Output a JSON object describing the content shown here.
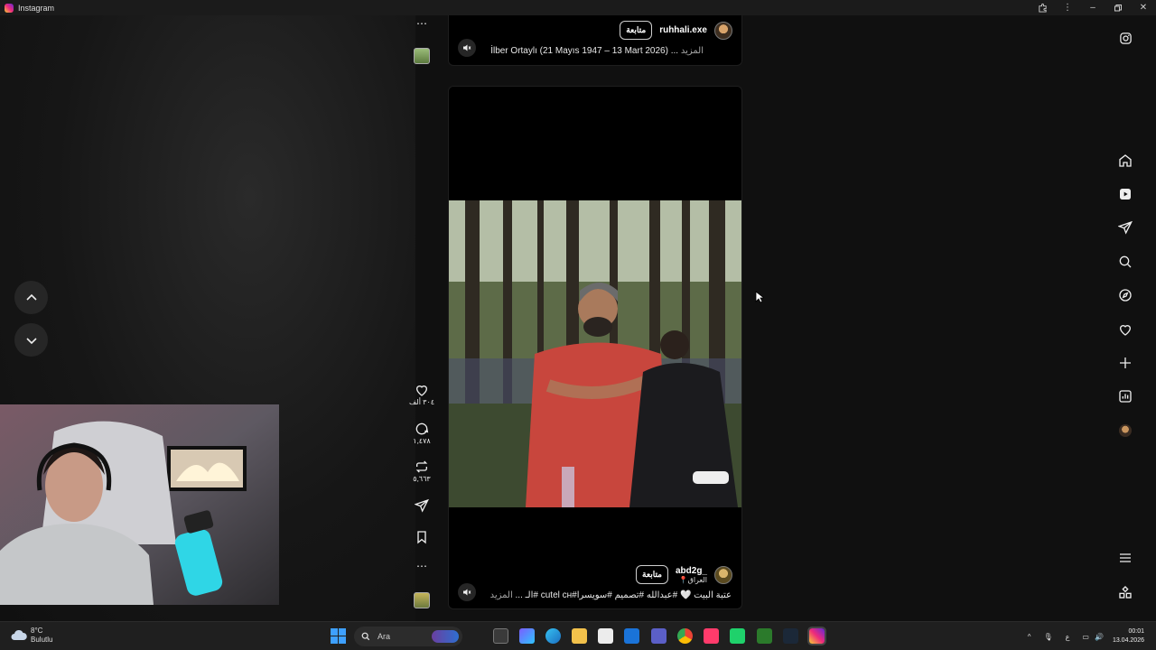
{
  "window": {
    "title": "Instagram"
  },
  "reel_top": {
    "username": "ruhhali.exe",
    "follow_label": "متابعة",
    "caption": "İlber Ortaylı (21 Mayıs 1947 – 13 Mart 2026) ...",
    "more_label": "المزيد"
  },
  "reel_main": {
    "username": "abd2g_",
    "location": "العراق",
    "follow_label": "متابعة",
    "caption": "عتبة البيت 🤍 #عبدالله #تصميم #سويسرا#cutel ᴄʜ #الـ ...",
    "more_label": "المزيد"
  },
  "actions": {
    "likes": "٣٠٤ ألف",
    "comments": "١,٤٧٨",
    "reposts": "٥,٦٦٣"
  },
  "sidebar": {
    "icons": [
      "instagram-icon",
      "home-icon",
      "reels-icon",
      "messages-icon",
      "search-icon",
      "explore-icon",
      "notifications-icon",
      "create-icon",
      "dashboard-icon",
      "profile-avatar",
      "more-menu-icon",
      "apps-icon"
    ]
  },
  "taskbar": {
    "weather_temp": "8°C",
    "weather_desc": "Bulutlu",
    "search_placeholder": "Ara",
    "lang": "ع",
    "time": "00:01",
    "date": "13.04.2026"
  },
  "colors": {
    "accent": "#ee2a7b",
    "bg": "#101010",
    "taskbar": "#1f1f1f"
  }
}
